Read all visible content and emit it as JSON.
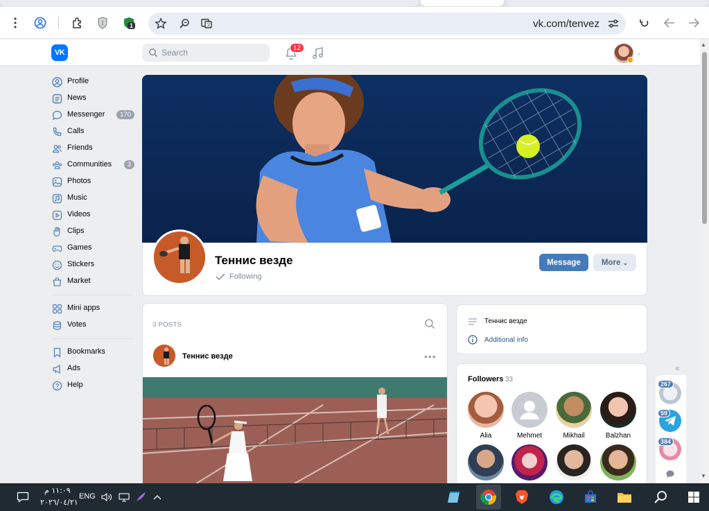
{
  "browser": {
    "url": "vk.com/tenvez",
    "extension_badge": "1"
  },
  "vk_header": {
    "logo_text": "VK",
    "search_placeholder": "Search",
    "notifications_count": "12"
  },
  "left_nav": {
    "items": [
      {
        "label": "Profile",
        "icon": "profile-icon"
      },
      {
        "label": "News",
        "icon": "news-icon"
      },
      {
        "label": "Messenger",
        "icon": "messenger-icon",
        "badge": "170"
      },
      {
        "label": "Calls",
        "icon": "phone-icon"
      },
      {
        "label": "Friends",
        "icon": "friends-icon"
      },
      {
        "label": "Communities",
        "icon": "communities-icon",
        "badge": "3"
      },
      {
        "label": "Photos",
        "icon": "photos-icon"
      },
      {
        "label": "Music",
        "icon": "music-icon"
      },
      {
        "label": "Videos",
        "icon": "videos-icon"
      },
      {
        "label": "Clips",
        "icon": "clips-icon"
      },
      {
        "label": "Games",
        "icon": "games-icon"
      },
      {
        "label": "Stickers",
        "icon": "stickers-icon"
      },
      {
        "label": "Market",
        "icon": "market-icon"
      }
    ],
    "items2": [
      {
        "label": "Mini apps",
        "icon": "mini-apps-icon"
      },
      {
        "label": "Votes",
        "icon": "votes-icon"
      }
    ],
    "items3": [
      {
        "label": "Bookmarks",
        "icon": "bookmarks-icon"
      },
      {
        "label": "Ads",
        "icon": "ads-icon"
      },
      {
        "label": "Help",
        "icon": "help-icon"
      }
    ]
  },
  "group": {
    "name": "Теннис везде",
    "following_label": "Following",
    "message_button": "Message",
    "more_button": "More"
  },
  "posts": {
    "count_label": "3 POSTS",
    "author": "Теннис везде"
  },
  "info": {
    "description": "Теннис везде",
    "additional_info": "Additional info"
  },
  "followers": {
    "title": "Followers",
    "count": "33",
    "people": [
      {
        "name": "Alia"
      },
      {
        "name": "Mehmet"
      },
      {
        "name": "Mikhail"
      },
      {
        "name": "Balzhan"
      }
    ]
  },
  "mini_panel": {
    "badges": [
      "267",
      "59",
      "384"
    ]
  },
  "taskbar": {
    "time": "١١:٠٩ م",
    "date": "٢٠٢٦/٠٤/٢١",
    "language": "ENG"
  }
}
